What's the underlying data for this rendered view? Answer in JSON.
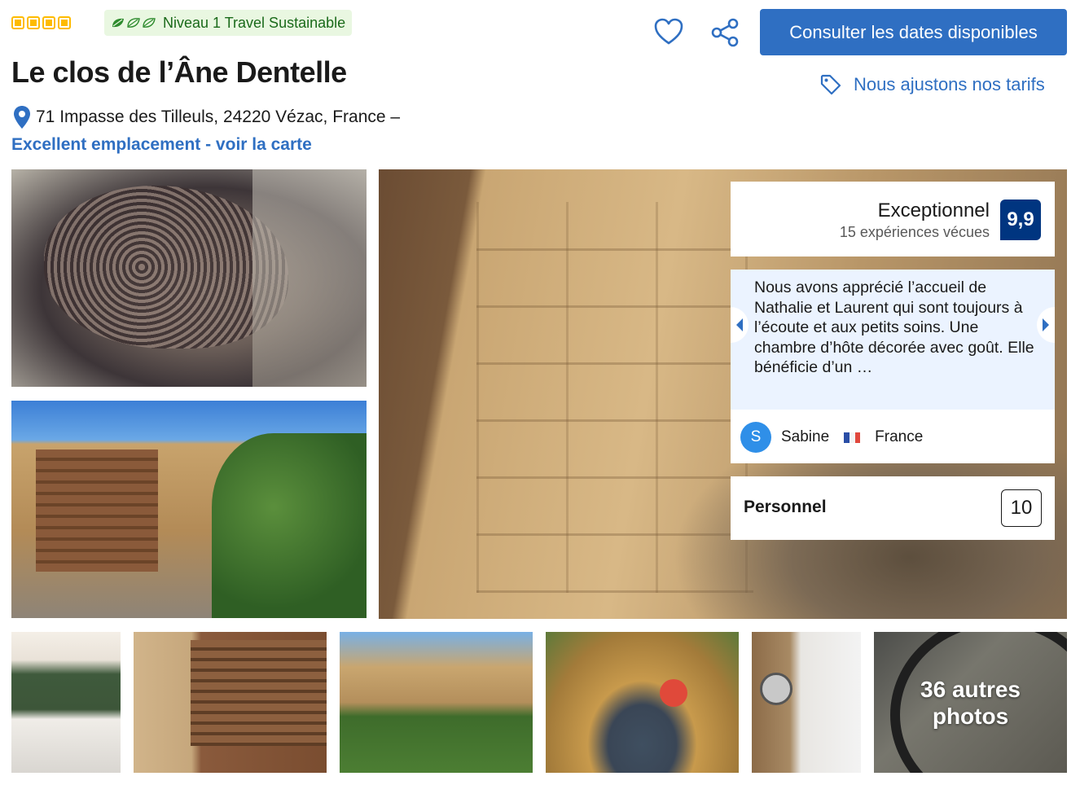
{
  "header": {
    "stars": 4,
    "sustainability_label": "Niveau 1 Travel Sustainable",
    "cta_label": "Consulter les dates disponibles",
    "price_match_label": "Nous ajustons nos tarifs",
    "icons": {
      "favorite": "heart-icon",
      "share": "share-icon",
      "price_tag": "tag-icon",
      "location": "map-pin-icon",
      "leaf": "leaf-icon"
    }
  },
  "property": {
    "name": "Le clos de l’Âne Dentelle",
    "address": "71 Impasse des Tilleuls, 24220 Vézac, France –",
    "location_link": "Excellent emplacement - voir la carte"
  },
  "review_summary": {
    "label": "Exceptionnel",
    "count": "15 expériences vécues",
    "score": "9,9"
  },
  "featured_review": {
    "text": "Nous avons apprécié l’accueil de Nathalie et Laurent qui sont toujours à l’écoute et aux petits soins. Une chambre d’hôte décorée avec goût. Elle bénéficie d’un …",
    "reviewer_initial": "S",
    "reviewer_name": "Sabine",
    "reviewer_country": "France"
  },
  "category_score": {
    "label": "Personnel",
    "score": "10"
  },
  "gallery": {
    "more_photos_label": "36 autres photos"
  },
  "colors": {
    "brand_blue": "#2f6fc2",
    "score_navy": "#003580",
    "sustain_bg": "#e9f7e1",
    "star_yellow": "#febb02"
  }
}
